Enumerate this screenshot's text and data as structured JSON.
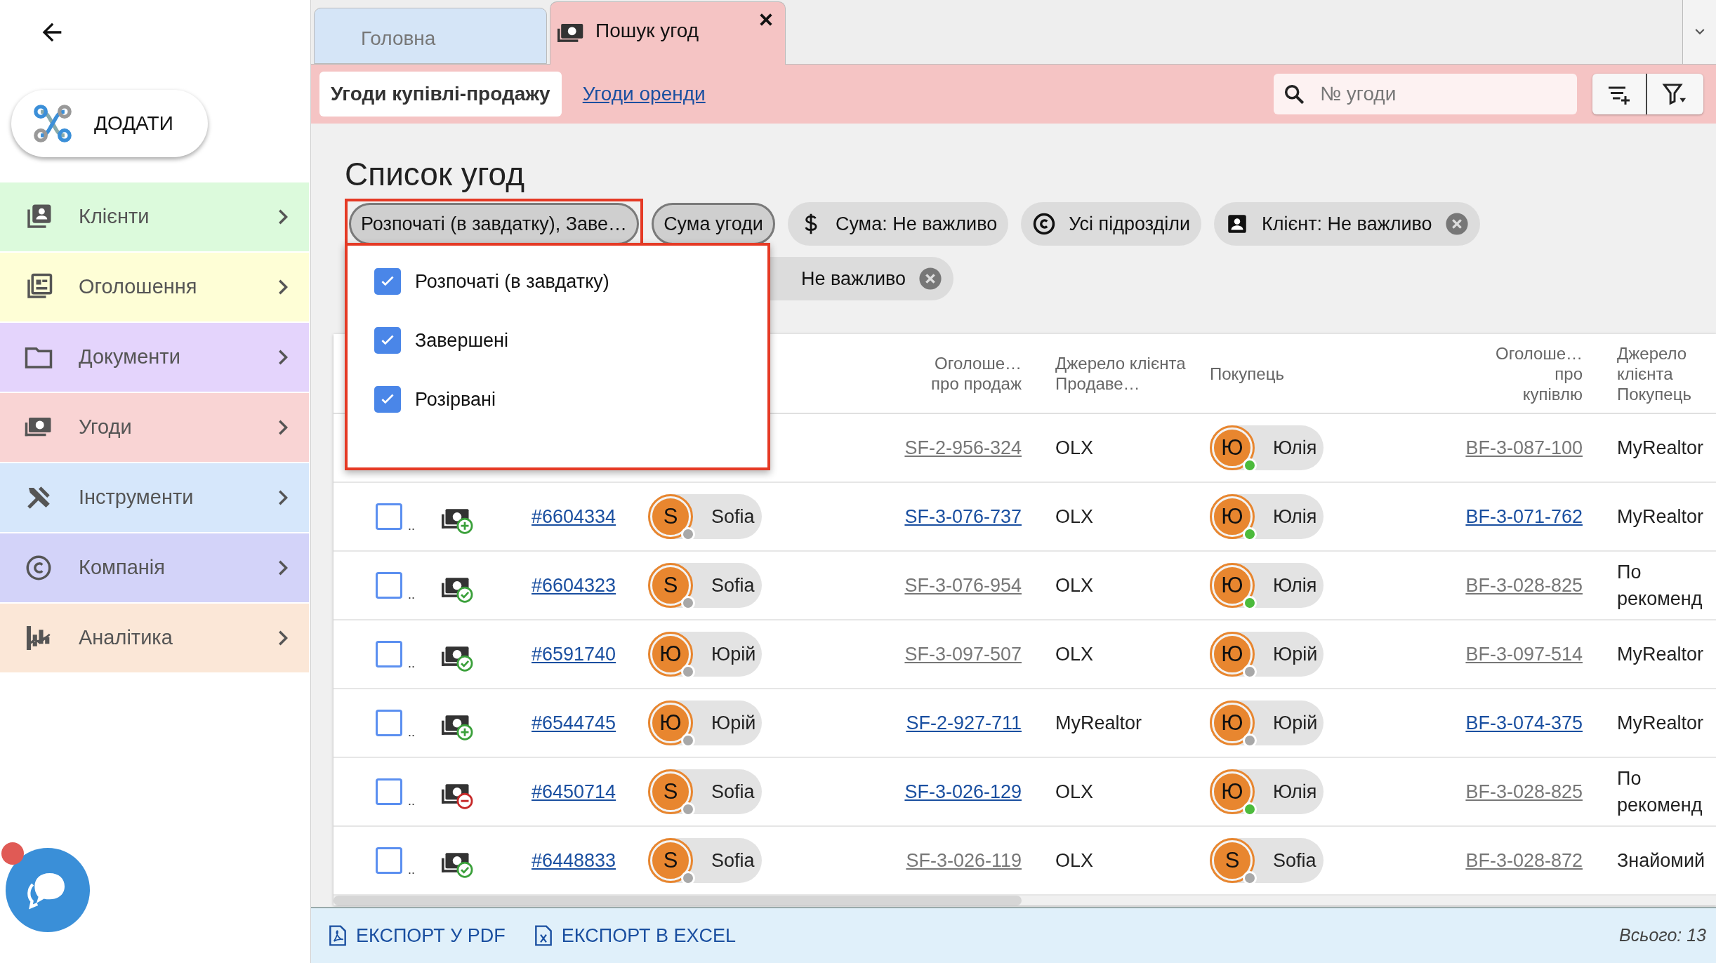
{
  "sidebar": {
    "add_button": "ДОДАТИ",
    "items": [
      {
        "label": "Клієнти",
        "kind": "clients",
        "color": "#dcfadc"
      },
      {
        "label": "Оголошення",
        "kind": "ads",
        "color": "#fefed6"
      },
      {
        "label": "Документи",
        "kind": "documents",
        "color": "#e4d4fc"
      },
      {
        "label": "Угоди",
        "kind": "deals",
        "color": "#f9d4d4"
      },
      {
        "label": "Інструменти",
        "kind": "tools",
        "color": "#d6e7fb"
      },
      {
        "label": "Компанія",
        "kind": "company",
        "color": "#d3d3f9"
      },
      {
        "label": "Аналітика",
        "kind": "analytics",
        "color": "#fbe7d7"
      }
    ],
    "chat_unread": true
  },
  "tabs": [
    {
      "label": "Головна",
      "selected": false,
      "closable": false
    },
    {
      "label": "Пошук угод",
      "selected": true,
      "closable": true
    }
  ],
  "toolbar": {
    "segments": [
      {
        "label": "Угоди купівлі-продажу",
        "selected": true
      },
      {
        "label": "Угоди оренди",
        "selected": false
      }
    ],
    "search": {
      "placeholder": "№ угоди"
    }
  },
  "title": "Список угод",
  "chips": [
    {
      "label": "Розпочаті (в завдатку), Заве…",
      "kind": "status",
      "removable": false,
      "highlighted": true
    },
    {
      "label": "Сума угоди",
      "kind": "sort",
      "removable": false,
      "highlighted": false
    },
    {
      "label": "Сума: Не важливо",
      "kind": "amount",
      "removable": false,
      "highlighted": false
    },
    {
      "label": "Усі підрозділи",
      "kind": "division",
      "removable": false,
      "highlighted": false
    },
    {
      "label": "Клієнт: Не важливо",
      "kind": "client",
      "removable": true,
      "highlighted": false
    },
    {
      "label": "Не важливо",
      "kind": "other",
      "removable": true,
      "highlighted": false
    }
  ],
  "dropdown": [
    {
      "label": "Розпочаті (в завдатку)",
      "checked": true
    },
    {
      "label": "Завершені",
      "checked": true
    },
    {
      "label": "Розірвані",
      "checked": true
    }
  ],
  "table": {
    "columns": [
      "Оголоше… про продаж",
      "Джерело клієнта Продаве…",
      "Покупець",
      "Оголоше… про купівлю",
      "Джерело клієнта Покупець"
    ],
    "rows": [
      {
        "ad_sale": {
          "text": "SF-2-956-324",
          "disabled": true
        },
        "source_seller": "OLX",
        "buyer": {
          "initial": "Ю",
          "name": "Юлія",
          "online": true
        },
        "ad_buy": {
          "text": "BF-3-087-100",
          "disabled": true
        },
        "source_buyer": "MyRealtor"
      },
      {
        "checked": false,
        "more": "..",
        "kind": "plus",
        "id": "#6604334",
        "seller": {
          "initial": "S",
          "name": "Sofia",
          "online": false
        },
        "ad_sale": {
          "text": "SF-3-076-737",
          "disabled": false
        },
        "source_seller": "OLX",
        "buyer": {
          "initial": "Ю",
          "name": "Юлія",
          "online": true
        },
        "ad_buy": {
          "text": "BF-3-071-762",
          "disabled": false
        },
        "source_buyer": "MyRealtor"
      },
      {
        "checked": false,
        "more": "..",
        "kind": "check",
        "id": "#6604323",
        "seller": {
          "initial": "S",
          "name": "Sofia",
          "online": false
        },
        "ad_sale": {
          "text": "SF-3-076-954",
          "disabled": true
        },
        "source_seller": "OLX",
        "buyer": {
          "initial": "Ю",
          "name": "Юлія",
          "online": true
        },
        "ad_buy": {
          "text": "BF-3-028-825",
          "disabled": true
        },
        "source_buyer": "По рекоменд"
      },
      {
        "checked": false,
        "more": "..",
        "kind": "check",
        "id": "#6591740",
        "seller": {
          "initial": "Ю",
          "name": "Юрій",
          "online": false
        },
        "ad_sale": {
          "text": "SF-3-097-507",
          "disabled": true
        },
        "source_seller": "OLX",
        "buyer": {
          "initial": "Ю",
          "name": "Юрій",
          "online": false
        },
        "ad_buy": {
          "text": "BF-3-097-514",
          "disabled": true
        },
        "source_buyer": "MyRealtor"
      },
      {
        "checked": false,
        "more": "..",
        "kind": "plus",
        "id": "#6544745",
        "seller": {
          "initial": "Ю",
          "name": "Юрій",
          "online": false
        },
        "ad_sale": {
          "text": "SF-2-927-711",
          "disabled": false
        },
        "source_seller": "MyRealtor",
        "buyer": {
          "initial": "Ю",
          "name": "Юрій",
          "online": false
        },
        "ad_buy": {
          "text": "BF-3-074-375",
          "disabled": false
        },
        "source_buyer": "MyRealtor"
      },
      {
        "checked": false,
        "more": "..",
        "kind": "minus",
        "id": "#6450714",
        "seller": {
          "initial": "S",
          "name": "Sofia",
          "online": false
        },
        "ad_sale": {
          "text": "SF-3-026-129",
          "disabled": false
        },
        "source_seller": "OLX",
        "buyer": {
          "initial": "Ю",
          "name": "Юлія",
          "online": true
        },
        "ad_buy": {
          "text": "BF-3-028-825",
          "disabled": true
        },
        "source_buyer": "По рекоменд"
      },
      {
        "checked": false,
        "more": "..",
        "kind": "check",
        "id": "#6448833",
        "seller": {
          "initial": "S",
          "name": "Sofia",
          "online": false
        },
        "ad_sale": {
          "text": "SF-3-026-119",
          "disabled": true
        },
        "source_seller": "OLX",
        "buyer": {
          "initial": "S",
          "name": "Sofia",
          "online": false
        },
        "ad_buy": {
          "text": "BF-3-028-872",
          "disabled": true
        },
        "source_buyer": "Знайомий"
      }
    ]
  },
  "footer": {
    "buttons": [
      {
        "label": "ЕКСПОРТ У PDF",
        "kind": "pdf"
      },
      {
        "label": "ЕКСПОРТ В EXCEL",
        "kind": "excel"
      }
    ],
    "total": "Всього: 13"
  }
}
